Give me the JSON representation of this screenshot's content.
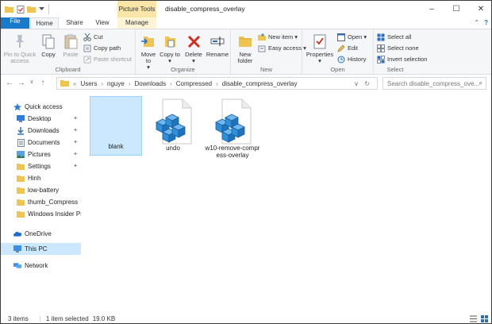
{
  "title_bar": {
    "context_tools": "Picture Tools",
    "window_title": "disable_compress_overlay",
    "minimize": "–",
    "maximize": "☐",
    "close": "✕"
  },
  "tabs": {
    "file": "File",
    "home": "Home",
    "share": "Share",
    "view": "View",
    "manage": "Manage"
  },
  "ribbon": {
    "clipboard": {
      "label": "Clipboard",
      "pin": "Pin to Quick access",
      "copy": "Copy",
      "paste": "Paste",
      "cut": "Cut",
      "copy_path": "Copy path",
      "paste_shortcut": "Paste shortcut"
    },
    "organize": {
      "label": "Organize",
      "move_to": "Move to",
      "copy_to": "Copy to",
      "delete": "Delete",
      "rename": "Rename"
    },
    "new": {
      "label": "New",
      "new_folder": "New folder",
      "new_item": "New item",
      "easy_access": "Easy access"
    },
    "open": {
      "label": "Open",
      "properties": "Properties",
      "open": "Open",
      "edit": "Edit",
      "history": "History"
    },
    "select": {
      "label": "Select",
      "select_all": "Select all",
      "select_none": "Select none",
      "invert": "Invert selection"
    }
  },
  "address": {
    "crumbs": [
      "Users",
      "nguye",
      "Downloads",
      "Compressed",
      "disable_compress_overlay"
    ],
    "prefix": "«",
    "search_placeholder": "Search disable_compress_ove..."
  },
  "nav": {
    "quick_access": "Quick access",
    "items": [
      "Desktop",
      "Downloads",
      "Documents",
      "Pictures",
      "Settings",
      "Hinh",
      "low-battery",
      "thumb_Compress",
      "Windows Insider Pro"
    ],
    "onedrive": "OneDrive",
    "this_pc": "This PC",
    "network": "Network"
  },
  "files": [
    {
      "name": "blank"
    },
    {
      "name": "undo"
    },
    {
      "name": "w10-remove-compress-overlay"
    }
  ],
  "status": {
    "items": "3 items",
    "selected": "1 item selected",
    "size": "19.0 KB"
  },
  "colors": {
    "accent": "#1979ca",
    "selection": "#cce8ff",
    "context_tab": "#f8e6a8",
    "folder": "#f0c450",
    "reg_blue": "#2f8fd8"
  }
}
